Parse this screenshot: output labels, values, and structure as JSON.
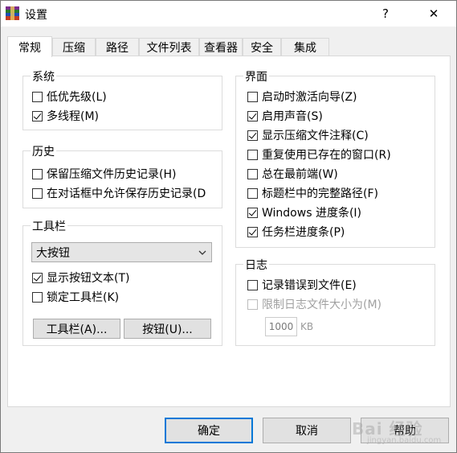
{
  "window": {
    "title": "设置"
  },
  "titlebar": {
    "help_label": "?",
    "close_label": "✕"
  },
  "tabs": [
    {
      "label": "常规"
    },
    {
      "label": "压缩"
    },
    {
      "label": "路径"
    },
    {
      "label": "文件列表"
    },
    {
      "label": "查看器"
    },
    {
      "label": "安全"
    },
    {
      "label": "集成"
    }
  ],
  "groups": {
    "system": {
      "title": "系统",
      "options": [
        {
          "label": "低优先级(L)",
          "checked": false
        },
        {
          "label": "多线程(M)",
          "checked": true
        }
      ]
    },
    "history": {
      "title": "历史",
      "options": [
        {
          "label": "保留压缩文件历史记录(H)",
          "checked": false
        },
        {
          "label": "在对话框中允许保存历史记录(D",
          "checked": false
        }
      ]
    },
    "toolbar": {
      "title": "工具栏",
      "dropdown_value": "大按钮",
      "options": [
        {
          "label": "显示按钮文本(T)",
          "checked": true
        },
        {
          "label": "锁定工具栏(K)",
          "checked": false
        }
      ],
      "toolbar_button": "工具栏(A)...",
      "buttons_button": "按钮(U)..."
    },
    "interface": {
      "title": "界面",
      "options": [
        {
          "label": "启动时激活向导(Z)",
          "checked": false
        },
        {
          "label": "启用声音(S)",
          "checked": true
        },
        {
          "label": "显示压缩文件注释(C)",
          "checked": true
        },
        {
          "label": "重复使用已存在的窗口(R)",
          "checked": false
        },
        {
          "label": "总在最前端(W)",
          "checked": false
        },
        {
          "label": "标题栏中的完整路径(F)",
          "checked": false
        },
        {
          "label": "Windows 进度条(I)",
          "checked": true
        },
        {
          "label": "任务栏进度条(P)",
          "checked": true
        }
      ]
    },
    "log": {
      "title": "日志",
      "options": [
        {
          "label": "记录错误到文件(E)",
          "checked": false,
          "disabled": false
        },
        {
          "label": "限制日志文件大小为(M)",
          "checked": false,
          "disabled": true
        }
      ],
      "size_value": "1000",
      "size_unit": "KB"
    }
  },
  "footer": {
    "ok_label": "确定",
    "cancel_label": "取消",
    "help_label": "帮助"
  },
  "watermark": {
    "text": "Bai 经验",
    "sub": "jingyan.baidu.com"
  }
}
